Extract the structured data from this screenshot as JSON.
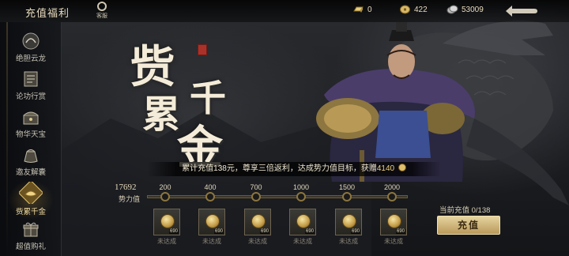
{
  "header": {
    "title": "充值福利",
    "customer_service_label": "客服",
    "resources": [
      {
        "icon": "gold-bar-icon",
        "value": "0"
      },
      {
        "icon": "copper-coin-icon",
        "value": "422"
      },
      {
        "icon": "silver-coin-icon",
        "value": "53009"
      }
    ]
  },
  "sidebar": {
    "items": [
      {
        "label": "绝胆云龙",
        "icon": "dragon-badge-icon",
        "active": false
      },
      {
        "label": "论功行赏",
        "icon": "scroll-icon",
        "active": false
      },
      {
        "label": "物华天宝",
        "icon": "treasure-icon",
        "active": false
      },
      {
        "label": "邀友解囊",
        "icon": "pouch-icon",
        "active": false
      },
      {
        "label": "赀累千金",
        "icon": "gold-ingot-icon",
        "active": true
      },
      {
        "label": "超值购礼",
        "icon": "gift-icon",
        "active": false
      }
    ]
  },
  "art": {
    "calligraphy": [
      "赀",
      "累",
      "千",
      "金"
    ]
  },
  "banner": {
    "text_prefix": "累计充值138元，尊享三倍返利，达成势力值目标，获赠",
    "reward_amount": "4140"
  },
  "progress": {
    "power_value": "17692",
    "power_label": "势力值",
    "fraction": 0,
    "milestones": [
      "200",
      "400",
      "700",
      "1000",
      "1500",
      "2000"
    ]
  },
  "rewards": [
    {
      "qty": "690",
      "status": "未达成"
    },
    {
      "qty": "690",
      "status": "未达成"
    },
    {
      "qty": "690",
      "status": "未达成"
    },
    {
      "qty": "690",
      "status": "未达成"
    },
    {
      "qty": "690",
      "status": "未达成"
    },
    {
      "qty": "690",
      "status": "未达成"
    }
  ],
  "recharge": {
    "current_label": "当前充值 0/138",
    "button_label": "充值"
  },
  "colors": {
    "accent_gold": "#c9a657",
    "banner_highlight": "#f0d17a",
    "button_top": "#e6d4a0"
  }
}
